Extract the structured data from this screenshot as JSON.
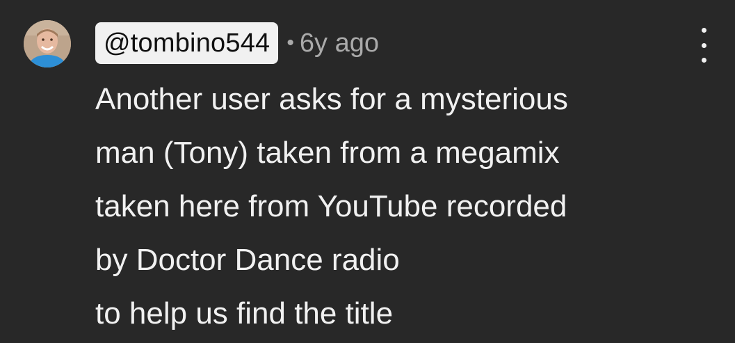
{
  "comment": {
    "author_handle": "@tombino544",
    "separator": "•",
    "timestamp": "6y ago",
    "menu_icon": "more-vertical-icon",
    "lines": [
      "Another user asks for a mysterious",
      "man (Tony) taken from a megamix",
      "taken here from YouTube recorded",
      "by Doctor Dance radio",
      "to help us find the title"
    ]
  },
  "colors": {
    "background": "#282828",
    "text": "#f1f1f1",
    "secondary_text": "#aaaaaa",
    "handle_badge": "#f1f1f1"
  }
}
